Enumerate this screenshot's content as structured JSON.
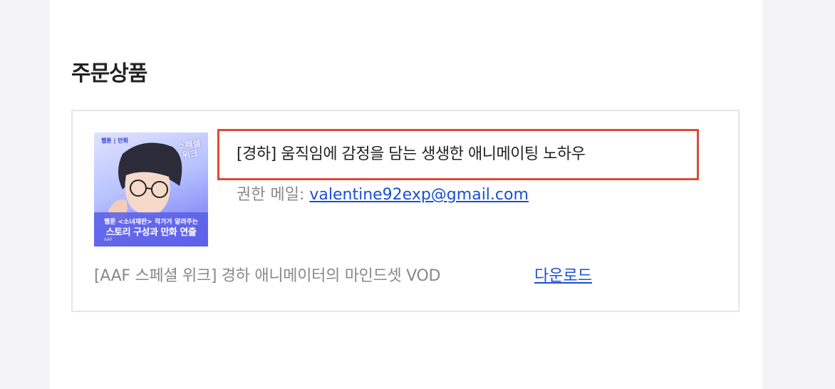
{
  "section": {
    "title": "주문상품"
  },
  "product": {
    "title": "[경하] 움직임에 감정을 담는 생생한 애니메이팅 노하우",
    "email_label": "권한 메일:",
    "email": "valentine92exp@gmail.com",
    "thumbnail": {
      "badge_top": "웹툰 | 만화",
      "badge_right": "스페셜 위크",
      "line1": "웹툰 <소녀재판> 작가가 알려주는",
      "line2": "스토리 구성과 만화 연출",
      "footer": "AAF"
    }
  },
  "vod": {
    "label": "[AAF 스페셜 위크] 경하 애니메이터의 마인드셋 VOD",
    "download_label": "다운로드"
  },
  "colors": {
    "highlight_border": "#dc4b37",
    "link": "#1a4fd6",
    "page_background": "#f4f4f6"
  }
}
